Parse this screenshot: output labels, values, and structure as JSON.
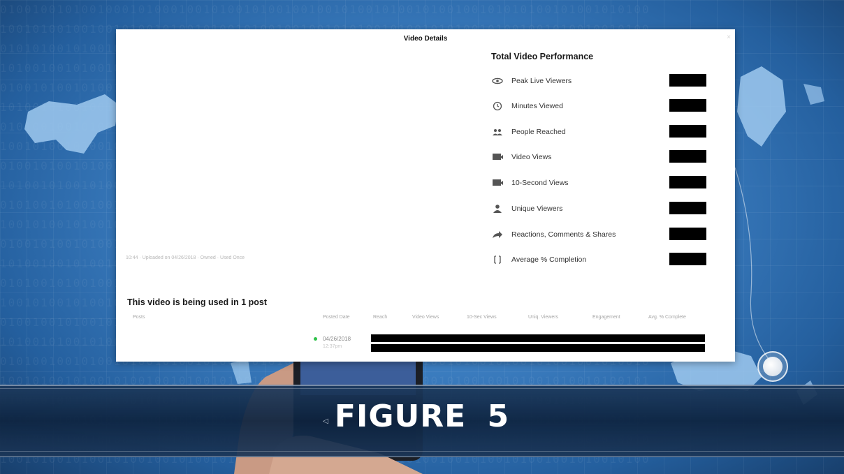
{
  "dialog": {
    "title": "Video Details",
    "close_glyph": "×",
    "video_meta": "10:44 · Uploaded on 04/26/2018 · Owned · Used Once"
  },
  "performance": {
    "heading": "Total Video Performance",
    "metrics": [
      {
        "icon": "eye-icon",
        "label": "Peak Live Viewers"
      },
      {
        "icon": "clock-icon",
        "label": "Minutes Viewed"
      },
      {
        "icon": "people-icon",
        "label": "People Reached"
      },
      {
        "icon": "video-icon",
        "label": "Video Views"
      },
      {
        "icon": "video-icon",
        "label": "10-Second Views"
      },
      {
        "icon": "person-icon",
        "label": "Unique Viewers"
      },
      {
        "icon": "share-arrow-icon",
        "label": "Reactions, Comments & Shares"
      },
      {
        "icon": "completion-icon",
        "label": "Average % Completion"
      }
    ],
    "value_redaction_color": "#000000"
  },
  "posts": {
    "heading": "This video is being used in 1 post",
    "columns": [
      "Posts",
      "Posted Date",
      "Reach",
      "Video Views",
      "10-Sec Views",
      "Uniq. Viewers",
      "Engagement",
      "Avg. % Complete"
    ],
    "rows": [
      {
        "date": "04/26/2018",
        "time": "12:37pm",
        "status_color": "#2fc24a"
      }
    ]
  },
  "caption": {
    "text": "FIGURE  5",
    "back_glyph": "◁"
  }
}
